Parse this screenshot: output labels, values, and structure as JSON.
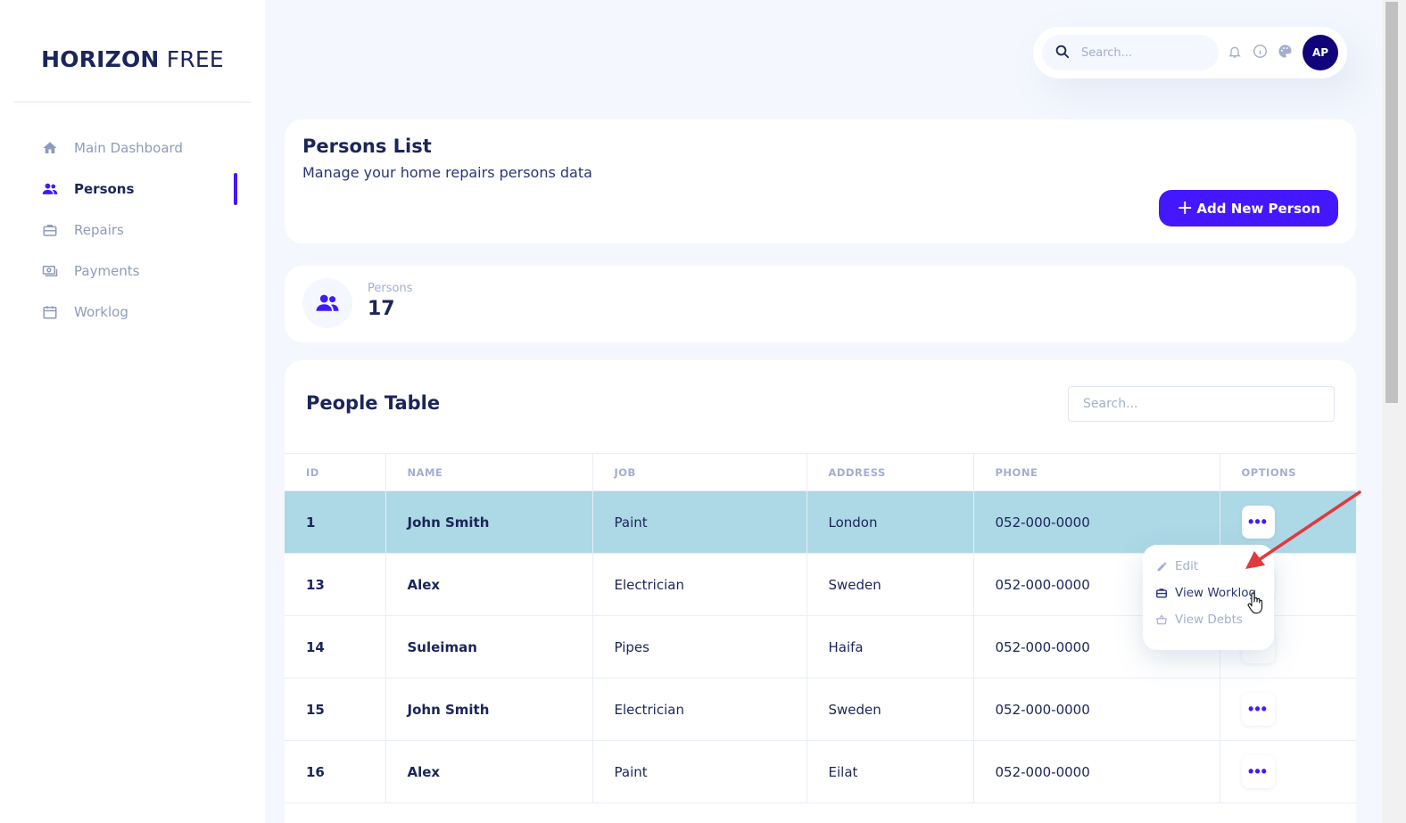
{
  "brand": {
    "bold": "HORIZON",
    "light": "FREE"
  },
  "sidebar": {
    "items": [
      {
        "label": "Main Dashboard",
        "icon": "home-icon",
        "active": false
      },
      {
        "label": "Persons",
        "icon": "users-icon",
        "active": true
      },
      {
        "label": "Repairs",
        "icon": "briefcase-icon",
        "active": false
      },
      {
        "label": "Payments",
        "icon": "money-icon",
        "active": false
      },
      {
        "label": "Worklog",
        "icon": "calendar-icon",
        "active": false
      }
    ]
  },
  "topbar": {
    "search_placeholder": "Search...",
    "icons": [
      "bell-icon",
      "info-icon",
      "palette-icon"
    ],
    "avatar_initials": "AP"
  },
  "header": {
    "title": "Persons List",
    "subtitle": "Manage your home repairs persons data",
    "add_button": "Add New Person"
  },
  "stat": {
    "label": "Persons",
    "value": "17"
  },
  "table": {
    "title": "People Table",
    "search_placeholder": "Search...",
    "columns": [
      "ID",
      "NAME",
      "JOB",
      "ADDRESS",
      "PHONE",
      "OPTIONS"
    ],
    "rows": [
      {
        "id": "1",
        "name": "John Smith",
        "job": "Paint",
        "address": "London",
        "phone": "052-000-0000",
        "selected": true
      },
      {
        "id": "13",
        "name": "Alex",
        "job": "Electrician",
        "address": "Sweden",
        "phone": "052-000-0000"
      },
      {
        "id": "14",
        "name": "Suleiman",
        "job": "Pipes",
        "address": "Haifa",
        "phone": "052-000-0000"
      },
      {
        "id": "15",
        "name": "John Smith",
        "job": "Electrician",
        "address": "Sweden",
        "phone": "052-000-0000"
      },
      {
        "id": "16",
        "name": "Alex",
        "job": "Paint",
        "address": "Eilat",
        "phone": "052-000-0000"
      }
    ],
    "options_glyph": "•••"
  },
  "dropdown": {
    "items": [
      {
        "label": "Edit",
        "icon": "pencil-icon"
      },
      {
        "label": "View Worklog",
        "icon": "briefcase-icon"
      },
      {
        "label": "View Debts",
        "icon": "basket-icon"
      }
    ]
  },
  "colors": {
    "accent": "#4318ff",
    "selected_row": "#add8e6",
    "text_dark": "#1b2559",
    "text_muted": "#a3aed0",
    "annotation_arrow": "#e0393e"
  }
}
